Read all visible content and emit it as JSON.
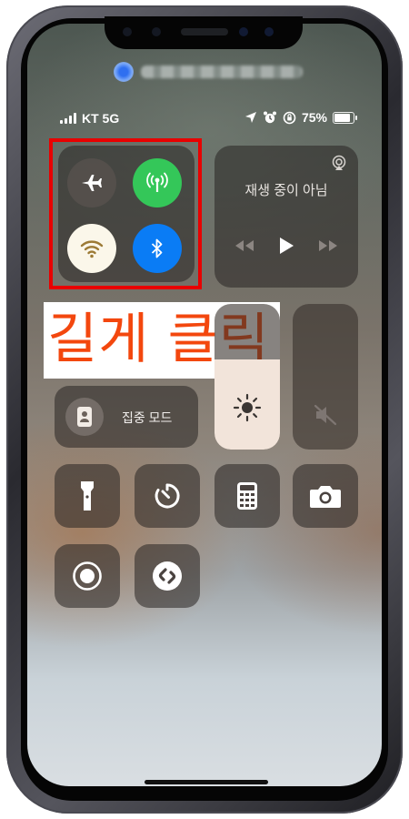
{
  "status_bar": {
    "carrier": "KT 5G",
    "battery_percent": "75%",
    "battery_level": 0.75
  },
  "connectivity": {
    "airplane_icon": "airplane-icon",
    "cellular_icon": "cellular-antenna-icon",
    "wifi_icon": "wifi-icon",
    "bluetooth_icon": "bluetooth-icon",
    "colors": {
      "cellular": "#34c759",
      "wifi": "#fbf7ea",
      "bluetooth": "#0a7cf5"
    }
  },
  "media": {
    "now_playing": "재생 중이 아님"
  },
  "annotation": {
    "text": "길게 클릭",
    "color": "#f3470e",
    "box_color": "#e80000"
  },
  "focus": {
    "label": "집중 모드"
  },
  "brightness": {
    "level": 0.62
  },
  "tiles": [
    "flashlight-icon",
    "timer-icon",
    "calculator-icon",
    "camera-icon",
    "screen-record-icon",
    "shazam-icon"
  ]
}
